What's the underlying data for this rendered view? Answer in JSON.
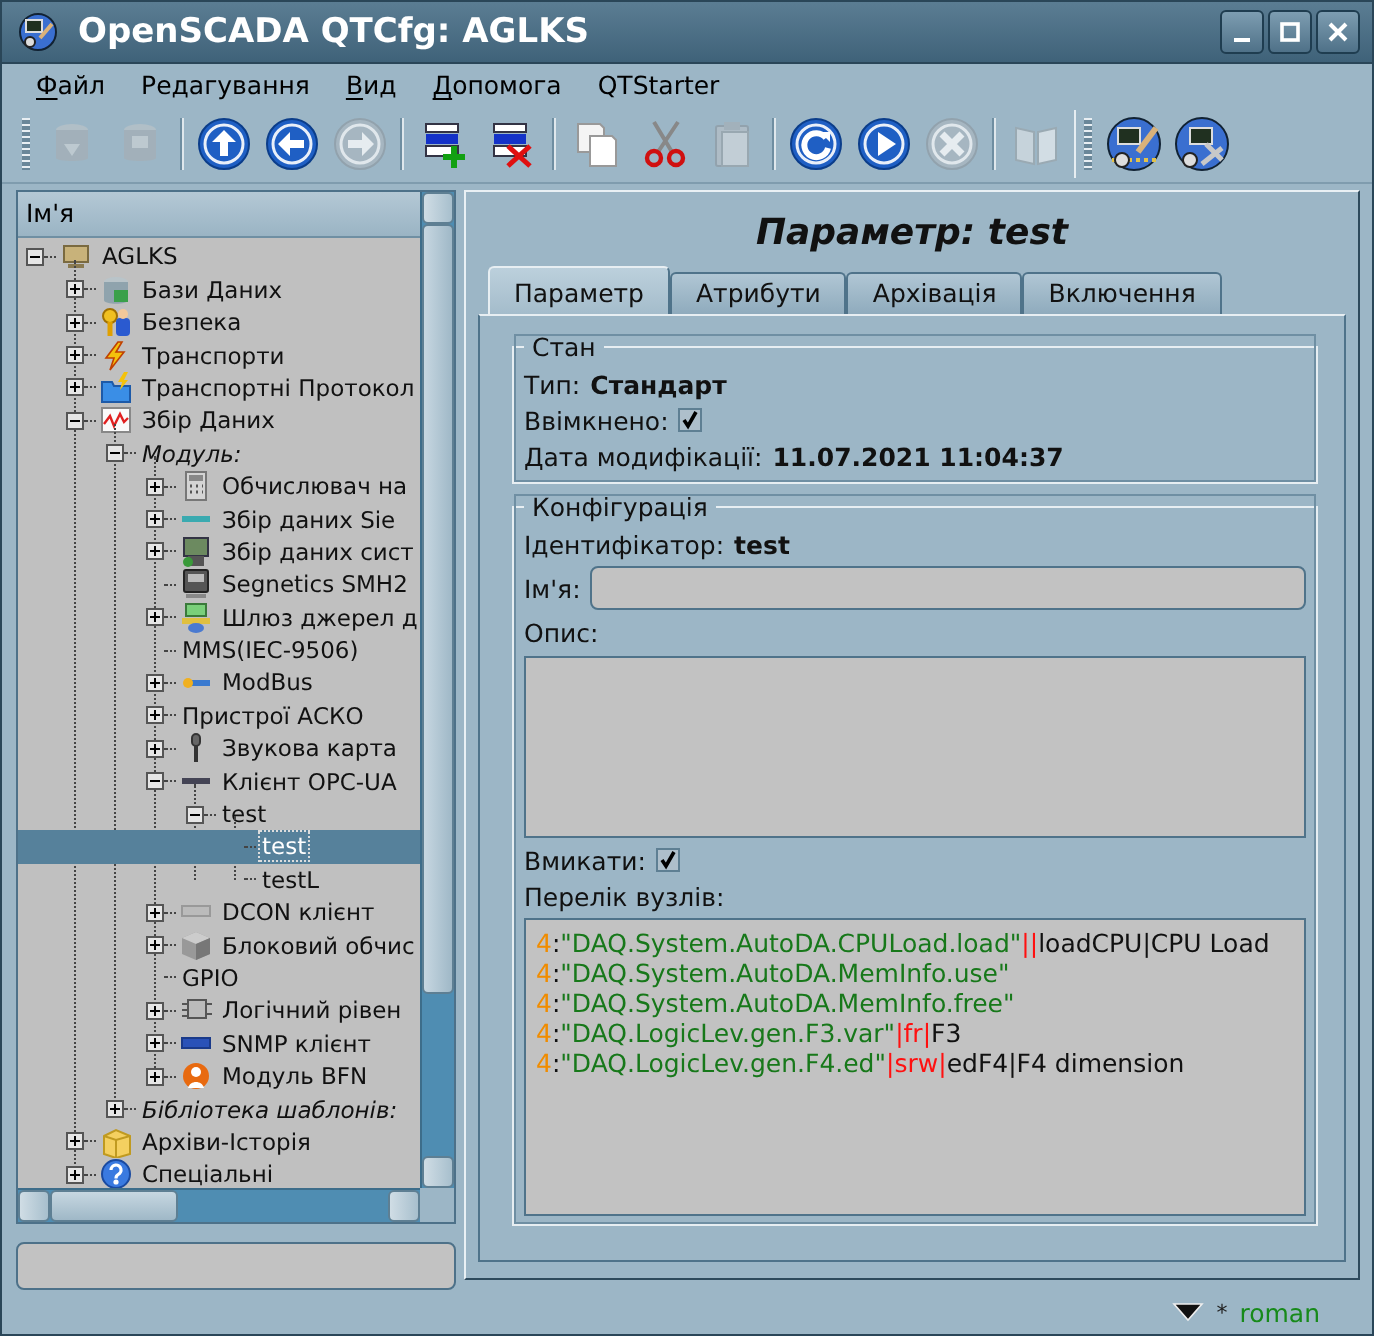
{
  "window": {
    "title": "OpenSCADA QTCfg: AGLKS"
  },
  "menu": [
    {
      "label": "Файл",
      "mnemonic_underlined": true
    },
    {
      "label": "Редагування",
      "mnemonic_underlined": false
    },
    {
      "label": "Вид",
      "mnemonic_underlined": true
    },
    {
      "label": "Допомога",
      "mnemonic_underlined": true
    },
    {
      "label": "QTStarter",
      "mnemonic_underlined": false
    }
  ],
  "toolbars": [
    {
      "items": [
        {
          "kind": "db-load",
          "disabled": true
        },
        {
          "kind": "db-save",
          "disabled": true
        },
        {
          "kind": "separator"
        },
        {
          "kind": "up",
          "disabled": false
        },
        {
          "kind": "back",
          "disabled": false
        },
        {
          "kind": "forward",
          "disabled": true
        },
        {
          "kind": "separator"
        },
        {
          "kind": "add",
          "disabled": false
        },
        {
          "kind": "delete",
          "disabled": false
        },
        {
          "kind": "separator"
        },
        {
          "kind": "copy",
          "disabled": false
        },
        {
          "kind": "cut",
          "disabled": false
        },
        {
          "kind": "paste",
          "disabled": true
        },
        {
          "kind": "separator"
        },
        {
          "kind": "refresh",
          "disabled": false
        },
        {
          "kind": "start",
          "disabled": false
        },
        {
          "kind": "stop",
          "disabled": true
        },
        {
          "kind": "separator"
        },
        {
          "kind": "manual",
          "disabled": true
        }
      ]
    },
    {
      "items": [
        {
          "kind": "station-link",
          "disabled": false
        },
        {
          "kind": "station-tools",
          "disabled": false
        }
      ]
    }
  ],
  "tree": {
    "header": "Ім'я",
    "items": [
      {
        "label": "AGLKS",
        "kind": "station",
        "expanded": true,
        "selected": false,
        "children": [
          {
            "label": "Бази Даних",
            "kind": "database",
            "expanded": false,
            "selected": false
          },
          {
            "label": "Безпека",
            "kind": "security",
            "expanded": false,
            "selected": false
          },
          {
            "label": "Транспорти",
            "kind": "transport",
            "expanded": false,
            "selected": false
          },
          {
            "label": "Транспортні Протокол",
            "kind": "protocol",
            "expanded": false,
            "selected": false
          },
          {
            "label": "Збір Даних",
            "kind": "daq",
            "expanded": true,
            "selected": false,
            "children": [
              {
                "label": "Модуль:",
                "kind": "group",
                "expanded": true,
                "selected": false,
                "children": [
                  {
                    "label": "Обчислювач на",
                    "kind": "calculator",
                    "expanded": false,
                    "selected": false
                  },
                  {
                    "label": "Збір даних Sie",
                    "kind": "siemens",
                    "expanded": false,
                    "selected": false
                  },
                  {
                    "label": "Збір даних сист",
                    "kind": "system",
                    "expanded": false,
                    "selected": false
                  },
                  {
                    "label": "Segnetics SMH2",
                    "kind": "device",
                    "selected": false
                  },
                  {
                    "label": "Шлюз джерел д",
                    "kind": "gateway",
                    "expanded": false,
                    "selected": false
                  },
                  {
                    "label": "MMS(IEC-9506)",
                    "selected": false
                  },
                  {
                    "label": "ModBus",
                    "kind": "modbus",
                    "expanded": false,
                    "selected": false
                  },
                  {
                    "label": "Пристрої АСКО",
                    "expanded": false,
                    "selected": false
                  },
                  {
                    "label": "Звукова карта",
                    "kind": "sound",
                    "expanded": false,
                    "selected": false
                  },
                  {
                    "label": "Клієнт OPC-UA",
                    "kind": "opc",
                    "expanded": true,
                    "selected": false,
                    "children": [
                      {
                        "label": "test",
                        "expanded": true,
                        "selected": false,
                        "children": [
                          {
                            "label": "test",
                            "selected": true
                          },
                          {
                            "label": "testL",
                            "selected": false
                          }
                        ]
                      }
                    ]
                  },
                  {
                    "label": "DCON клієнт",
                    "kind": "dcon",
                    "expanded": false,
                    "selected": false
                  },
                  {
                    "label": "Блоковий обчис",
                    "kind": "block",
                    "expanded": false,
                    "selected": false
                  },
                  {
                    "label": "GPIO",
                    "selected": false
                  },
                  {
                    "label": "Логічний рівен",
                    "kind": "logic",
                    "expanded": false,
                    "selected": false
                  },
                  {
                    "label": "SNMP клієнт",
                    "kind": "snmp",
                    "expanded": false,
                    "selected": false
                  },
                  {
                    "label": "Модуль BFN",
                    "kind": "bfn",
                    "expanded": false,
                    "selected": false
                  }
                ]
              },
              {
                "label": "Бібліотека шаблонів:",
                "kind": "group",
                "expanded": false,
                "selected": false
              }
            ]
          },
          {
            "label": "Архіви-Історія",
            "kind": "archive",
            "expanded": false,
            "selected": false
          },
          {
            "label": "Спеціальні",
            "kind": "help",
            "expanded": false,
            "selected": false
          }
        ]
      }
    ]
  },
  "panel": {
    "title": "Параметр: test",
    "tabs": [
      {
        "label": "Параметр",
        "selected": true
      },
      {
        "label": "Атрибути",
        "selected": false
      },
      {
        "label": "Архівація",
        "selected": false
      },
      {
        "label": "Включення",
        "selected": false
      }
    ],
    "state_group": {
      "title": "Стан",
      "type_label": "Тип:",
      "type_value": "Стандарт",
      "enabled_label": "Ввімкнено:",
      "enabled": true,
      "modified_label": "Дата модифікації:",
      "modified_value": "11.07.2021 11:04:37"
    },
    "config_group": {
      "title": "Конфігурація",
      "id_label": "Ідентифікатор:",
      "id_value": "test",
      "name_label": "Ім'я:",
      "description_label": "Опис:",
      "enable_label": "Вмикати:",
      "enable": true,
      "nodes_label": "Перелік вузлів:",
      "nodes": [
        [
          {
            "kind": "ns",
            "text": "4"
          },
          {
            "kind": "plain",
            "text": ":"
          },
          {
            "kind": "path",
            "text": "\"DAQ.System.AutoDA.CPULoad.load\""
          },
          {
            "kind": "flag",
            "text": "||"
          },
          {
            "kind": "plain",
            "text": "loadCPU|CPU Load"
          }
        ],
        [
          {
            "kind": "ns",
            "text": "4"
          },
          {
            "kind": "plain",
            "text": ":"
          },
          {
            "kind": "path",
            "text": "\"DAQ.System.AutoDA.MemInfo.use\""
          }
        ],
        [
          {
            "kind": "ns",
            "text": "4"
          },
          {
            "kind": "plain",
            "text": ":"
          },
          {
            "kind": "path",
            "text": "\"DAQ.System.AutoDA.MemInfo.free\""
          }
        ],
        [
          {
            "kind": "ns",
            "text": "4"
          },
          {
            "kind": "plain",
            "text": ":"
          },
          {
            "kind": "path",
            "text": "\"DAQ.LogicLev.gen.F3.var\""
          },
          {
            "kind": "flag",
            "text": "|fr|"
          },
          {
            "kind": "plain",
            "text": "F3"
          }
        ],
        [
          {
            "kind": "ns",
            "text": "4"
          },
          {
            "kind": "plain",
            "text": ":"
          },
          {
            "kind": "path",
            "text": "\"DAQ.LogicLev.gen.F4.ed\""
          },
          {
            "kind": "flag",
            "text": "|srw|"
          },
          {
            "kind": "plain",
            "text": "edF4|F4 dimension"
          }
        ]
      ]
    }
  },
  "status_bar": {
    "marker": "*",
    "user": "roman"
  }
}
